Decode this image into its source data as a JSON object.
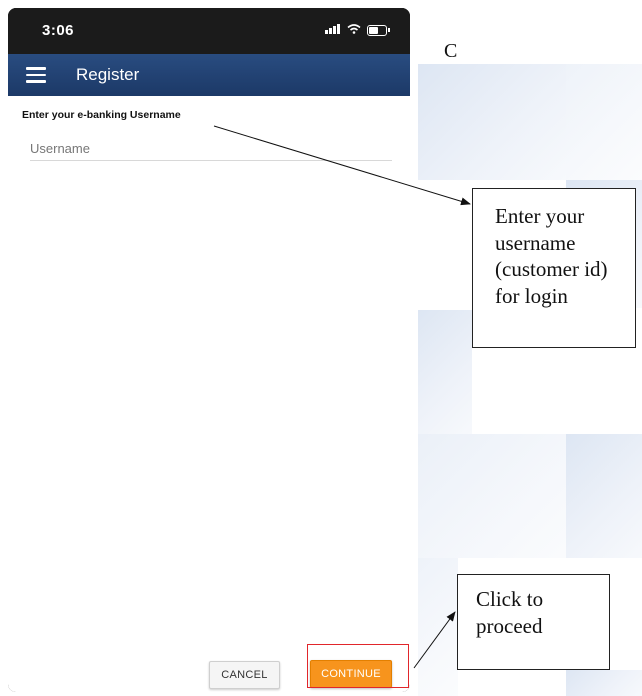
{
  "status_bar": {
    "time": "3:06",
    "signal_icon": "signal-icon",
    "wifi_icon": "wifi-icon",
    "battery_icon": "battery-icon"
  },
  "app_bar": {
    "menu_icon": "hamburger-menu-icon",
    "title": "Register",
    "background_color": "#1f3d6e"
  },
  "form": {
    "prompt": "Enter your e-banking Username",
    "username_placeholder": "Username",
    "username_value": ""
  },
  "actions": {
    "cancel_label": "CANCEL",
    "continue_label": "CONTINUE",
    "continue_color": "#f7941d"
  },
  "annotations": {
    "corner_letter": "C",
    "callout_username": "Enter your username (customer id) for login",
    "callout_continue": "Click to proceed",
    "highlight_color": "#e1262b"
  }
}
